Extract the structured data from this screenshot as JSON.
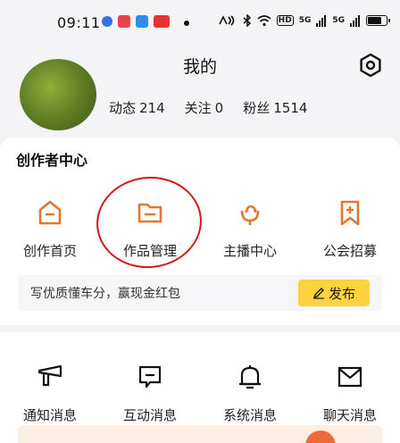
{
  "status_bar": {
    "time": "09:11",
    "network_badge": "HD",
    "signal_1": "5G",
    "signal_2": "5G"
  },
  "header": {
    "title": "我的",
    "settings_icon": "hexagon-settings-icon"
  },
  "profile": {
    "stats": [
      {
        "label": "动态",
        "value": "214"
      },
      {
        "label": "关注",
        "value": "0"
      },
      {
        "label": "粉丝",
        "value": "1514"
      }
    ]
  },
  "creator_center": {
    "title": "创作者中心",
    "items": [
      {
        "label": "创作首页",
        "icon": "home-icon"
      },
      {
        "label": "作品管理",
        "icon": "folder-icon"
      },
      {
        "label": "主播中心",
        "icon": "microphone-icon"
      },
      {
        "label": "公会招募",
        "icon": "bookmark-plus-icon"
      }
    ],
    "promo_text": "写优质懂车分，赢现金红包",
    "publish_label": "发布"
  },
  "messages": {
    "items": [
      {
        "label": "通知消息",
        "icon": "megaphone-icon"
      },
      {
        "label": "互动消息",
        "icon": "chat-icon"
      },
      {
        "label": "系统消息",
        "icon": "bell-icon"
      },
      {
        "label": "聊天消息",
        "icon": "mail-icon"
      }
    ]
  },
  "colors": {
    "accent_orange": "#e0782f",
    "publish_yellow": "#ffd23f",
    "annotation_red": "#d11b1b"
  }
}
